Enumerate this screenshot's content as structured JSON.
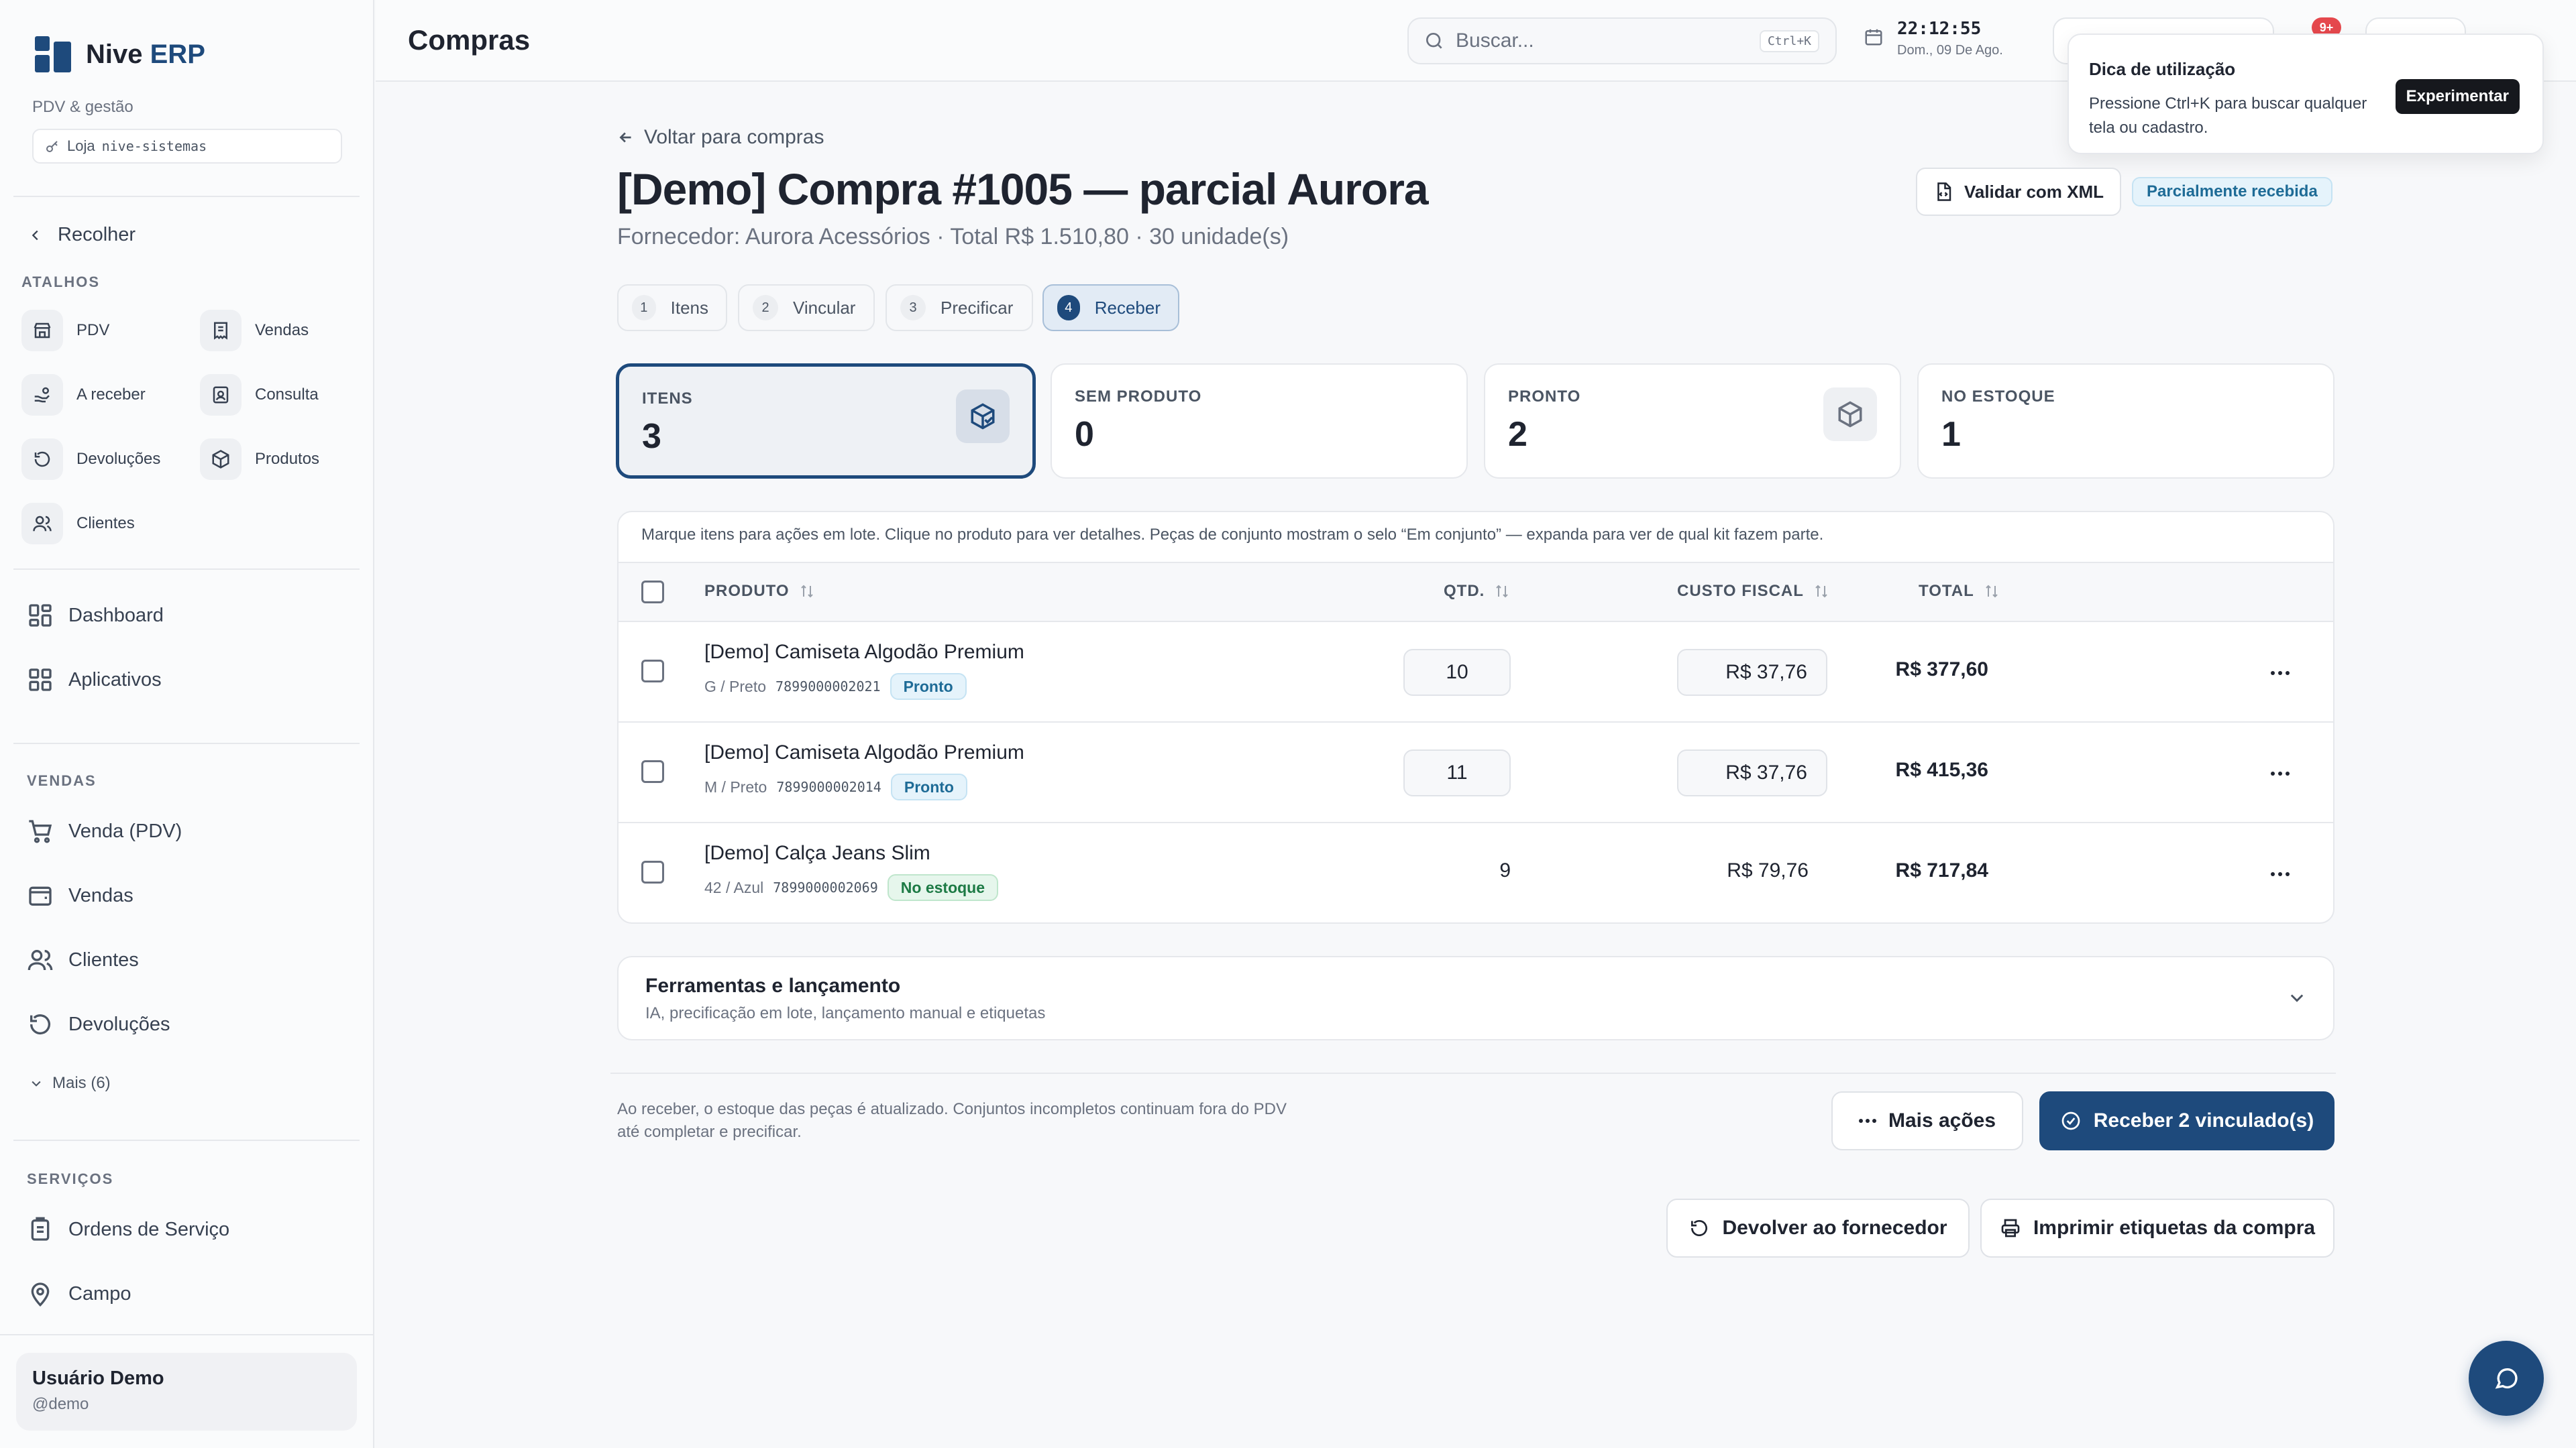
{
  "app": {
    "name_part1": "Nive",
    "name_part2": "ERP",
    "subtitle": "PDV & gestão",
    "store_prefix": "Loja",
    "store_code": "nive-sistemas"
  },
  "sidebar": {
    "collapse_label": "Recolher",
    "shortcuts_label": "ATALHOS",
    "shortcuts": [
      {
        "label": "PDV",
        "icon": "store-icon"
      },
      {
        "label": "Vendas",
        "icon": "receipt-icon"
      },
      {
        "label": "A receber",
        "icon": "hand-coins-icon"
      },
      {
        "label": "Consulta",
        "icon": "id-card-icon"
      },
      {
        "label": "Devoluções",
        "icon": "undo-circle-icon"
      },
      {
        "label": "Produtos",
        "icon": "package-icon"
      },
      {
        "label": "Clientes",
        "icon": "users-icon"
      }
    ],
    "main_items": [
      {
        "label": "Dashboard"
      },
      {
        "label": "Aplicativos"
      }
    ],
    "sales_label": "VENDAS",
    "sales_items": [
      {
        "label": "Venda (PDV)"
      },
      {
        "label": "Vendas"
      },
      {
        "label": "Clientes"
      },
      {
        "label": "Devoluções"
      }
    ],
    "more_label": "Mais (6)",
    "services_label": "SERVIÇOS",
    "services_items": [
      {
        "label": "Ordens de Serviço"
      },
      {
        "label": "Campo"
      }
    ],
    "user": {
      "name": "Usuário Demo",
      "handle": "@demo"
    }
  },
  "topbar": {
    "title": "Compras",
    "search_placeholder": "Buscar...",
    "search_shortcut": "Ctrl+K",
    "time": "22:12:55",
    "date": "Dom., 09 De Ago.",
    "notifications_badge": "9+"
  },
  "tip": {
    "title": "Dica de utilização",
    "body": "Pressione Ctrl+K para buscar qualquer tela ou cadastro.",
    "action": "Experimentar"
  },
  "purchase": {
    "back_label": "Voltar para compras",
    "title": "[Demo] Compra #1005 — parcial Aurora",
    "supplier_line": "Fornecedor: Aurora Acessórios · Total R$ 1.510,80 · 30 unidade(s)",
    "validate_xml": "Validar com XML",
    "status": "Parcialmente recebida"
  },
  "steps": [
    {
      "num": "1",
      "label": "Itens"
    },
    {
      "num": "2",
      "label": "Vincular"
    },
    {
      "num": "3",
      "label": "Precificar"
    },
    {
      "num": "4",
      "label": "Receber"
    }
  ],
  "cards": [
    {
      "label": "ITENS",
      "value": "3"
    },
    {
      "label": "SEM PRODUTO",
      "value": "0"
    },
    {
      "label": "PRONTO",
      "value": "2"
    },
    {
      "label": "NO ESTOQUE",
      "value": "1"
    }
  ],
  "table": {
    "hint": "Marque itens para ações em lote. Clique no produto para ver detalhes. Peças de conjunto mostram o selo “Em conjunto” — expanda para ver de qual kit fazem parte.",
    "headers": {
      "product": "PRODUTO",
      "qty": "QTD.",
      "cost": "CUSTO FISCAL",
      "total": "TOTAL"
    },
    "rows": [
      {
        "name": "[Demo] Camiseta Algodão Premium",
        "variant": "G / Preto",
        "barcode": "7899000002021",
        "status": "Pronto",
        "qty": "10",
        "cost": "R$ 37,76",
        "total": "R$ 377,60"
      },
      {
        "name": "[Demo] Camiseta Algodão Premium",
        "variant": "M / Preto",
        "barcode": "7899000002014",
        "status": "Pronto",
        "qty": "11",
        "cost": "R$ 37,76",
        "total": "R$ 415,36"
      },
      {
        "name": "[Demo] Calça Jeans Slim",
        "variant": "42 / Azul",
        "barcode": "7899000002069",
        "status": "No estoque",
        "qty": "9",
        "cost": "R$ 79,76",
        "total": "R$ 717,84"
      }
    ]
  },
  "tools": {
    "title": "Ferramentas e lançamento",
    "subtitle": "IA, precificação em lote, lançamento manual e etiquetas"
  },
  "footer": {
    "note": "Ao receber, o estoque das peças é atualizado. Conjuntos incompletos continuam fora do PDV até completar e precificar.",
    "more_actions": "Mais ações",
    "receive": "Receber 2 vinculado(s)",
    "return_supplier": "Devolver ao fornecedor",
    "print_labels": "Imprimir etiquetas da compra"
  },
  "colors": {
    "primary": "#1e4a7c",
    "badge_blue": "#1e6b96",
    "badge_green": "#1d7a45",
    "notif_red": "#e5484d"
  }
}
